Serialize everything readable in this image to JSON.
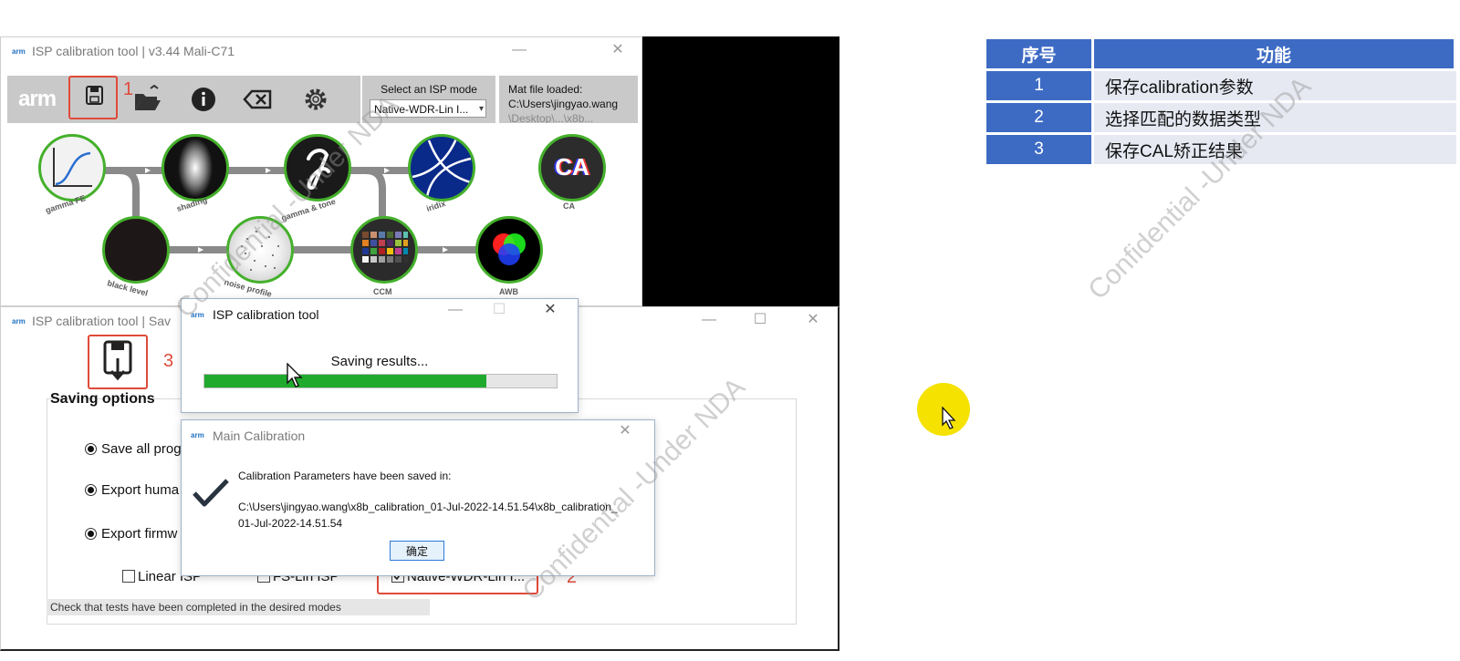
{
  "top_window": {
    "title": "ISP calibration tool | v3.44 Mali-C71",
    "arm_mini": "arm",
    "logo": "arm",
    "minimize": "—",
    "close": "✕",
    "step1_label": "1",
    "mode": {
      "label": "Select an ISP mode",
      "value": "Native-WDR-Lin I..."
    },
    "mat": {
      "label": "Mat file loaded:",
      "path": "C:\\Users\\jingyao.wang",
      "path_cont": "\\Desktop\\...\\x8b..."
    },
    "nodes": [
      {
        "label": "gamma FE"
      },
      {
        "label": "shading"
      },
      {
        "label": "gamma & tone"
      },
      {
        "label": "iridix"
      },
      {
        "label": "CA",
        "inner_text": "CA"
      },
      {
        "label": "black level"
      },
      {
        "label": "noise profile"
      },
      {
        "label": "CCM"
      },
      {
        "label": "AWB"
      }
    ]
  },
  "bottom_window": {
    "title": "ISP calibration tool | Sav",
    "arm_mini": "arm",
    "step3_label": "3",
    "saving_options": "Saving options",
    "radios": [
      "Save all prog",
      "Export huma",
      "Export firmw"
    ],
    "checkboxes": [
      {
        "label": "Linear ISP",
        "checked": false
      },
      {
        "label": "FS-Lin ISP",
        "checked": false
      },
      {
        "label": "Native-WDR-Lin I...",
        "checked": true
      }
    ],
    "step2_label": "2",
    "status": "Check that tests have been completed in the desired modes"
  },
  "progress_dialog": {
    "arm_mini": "arm",
    "title": "ISP calibration tool",
    "message": "Saving results...",
    "progress": 0.8
  },
  "main_dialog": {
    "arm_mini": "arm",
    "title": "Main Calibration",
    "message": "Calibration Parameters have been saved in:",
    "path_line1": "C:\\Users\\jingyao.wang\\x8b_calibration_01-Jul-2022-14.51.54\\x8b_calibration_",
    "path_line2": "01-Jul-2022-14.51.54",
    "ok": "确定"
  },
  "table": {
    "headers": [
      "序号",
      "功能"
    ],
    "rows": [
      {
        "num": "1",
        "func": "保存calibration参数"
      },
      {
        "num": "2",
        "func": "选择匹配的数据类型"
      },
      {
        "num": "3",
        "func": "保存CAL矫正结果"
      }
    ]
  },
  "watermark": "Confidential -Under NDA",
  "colors": {
    "accent_green": "#44b02b",
    "progress_green": "#1faa2e",
    "highlight_red": "#e04a3a",
    "table_blue": "#3d6bc4",
    "cursor_highlight": "#f5e200"
  }
}
